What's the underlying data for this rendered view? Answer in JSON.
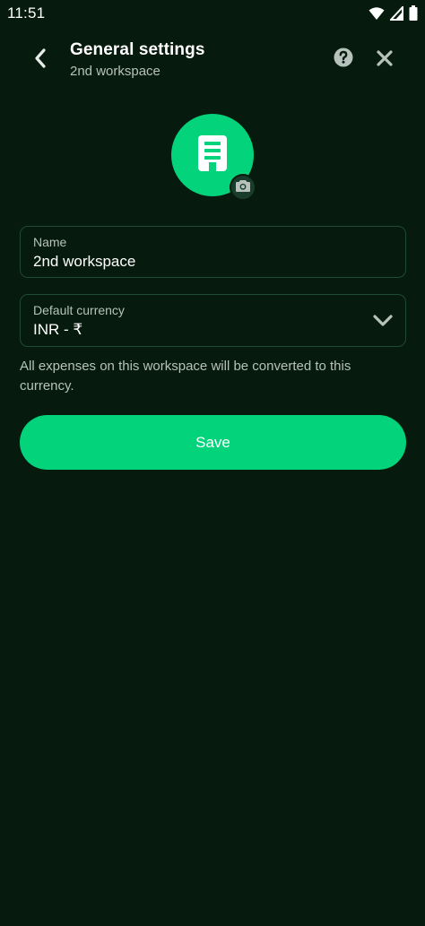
{
  "status_bar": {
    "time": "11:51",
    "icons": [
      "wifi-icon",
      "signal-icon",
      "battery-icon"
    ]
  },
  "header": {
    "title": "General settings",
    "subtitle": "2nd workspace",
    "back_icon": "chevron-left-icon",
    "help_icon": "question-circle-icon",
    "close_icon": "close-icon"
  },
  "avatar": {
    "icon": "building-icon",
    "badge_icon": "camera-icon",
    "color": "#03d47c"
  },
  "form": {
    "name": {
      "label": "Name",
      "value": "2nd workspace"
    },
    "currency": {
      "label": "Default currency",
      "value": "INR - ₹",
      "icon": "chevron-down-icon"
    },
    "helper_text": "All expenses on this workspace will be converted to this currency."
  },
  "actions": {
    "save_label": "Save"
  },
  "colors": {
    "background": "#061a0d",
    "accent": "#03d47c",
    "border": "#1f4a33",
    "muted_text": "#b6c2bb"
  }
}
